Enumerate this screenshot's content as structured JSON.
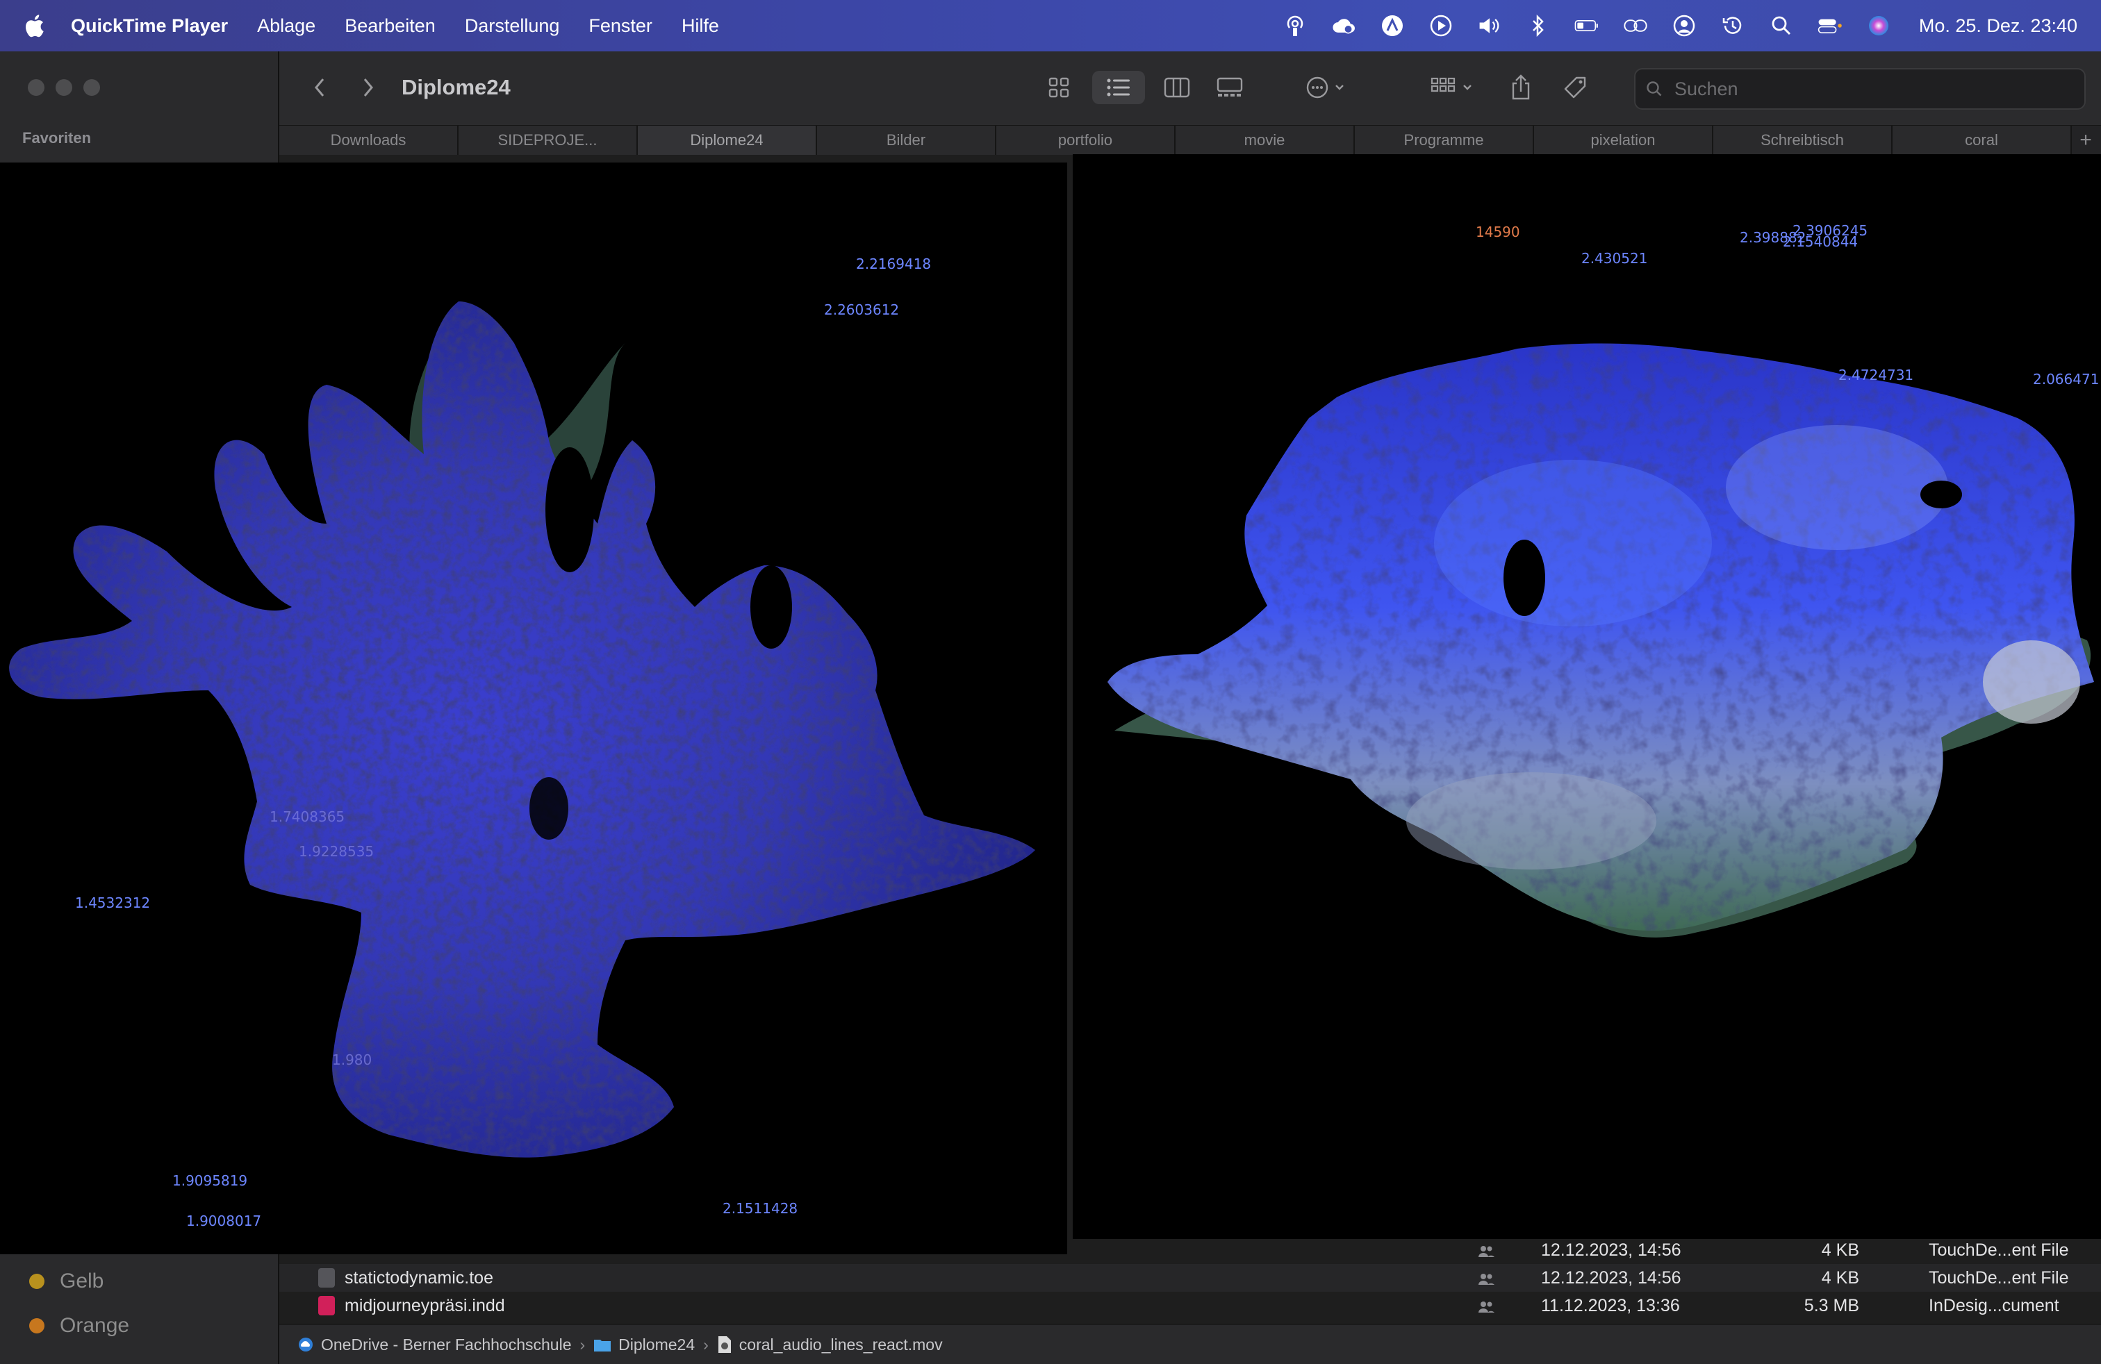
{
  "menubar": {
    "app_name": "QuickTime Player",
    "menus": [
      "Ablage",
      "Bearbeiten",
      "Darstellung",
      "Fenster",
      "Hilfe"
    ],
    "clock": "Mo. 25. Dez. 23:40",
    "status_icons": [
      "airdrop-icon",
      "creative-cloud-icon",
      "app-icon",
      "play-icon",
      "volume-icon",
      "bluetooth-icon",
      "battery-icon",
      "screen-mirroring-icon",
      "user-icon",
      "time-machine-icon",
      "search-icon",
      "control-center-icon",
      "siri-icon"
    ]
  },
  "finder": {
    "folder_title": "Diplome24",
    "search_placeholder": "Suchen",
    "sidebar": {
      "heading": "Favoriten",
      "tags": [
        {
          "label": "Gelb",
          "color": "#b8911e"
        },
        {
          "label": "Orange",
          "color": "#c7771e"
        }
      ]
    },
    "tabs": [
      "Downloads",
      "SIDEPROJE...",
      "Diplome24",
      "Bilder",
      "portfolio",
      "movie",
      "Programme",
      "pixelation",
      "Schreibtisch",
      "coral"
    ],
    "active_tab": "Diplome24",
    "files": [
      {
        "name": "statictodynamic.toe",
        "date": "12.12.2023, 14:56",
        "size": "4 KB",
        "kind": "TouchDe...ent File"
      },
      {
        "name": "midjourneypräsi.indd",
        "date": "11.12.2023, 13:36",
        "size": "5.3 MB",
        "kind": "InDesig...cument"
      }
    ],
    "partial_file": {
      "date": "12.12.2023, 14:56",
      "size": "4 KB",
      "kind": "TouchDe...ent File"
    },
    "path": [
      "OneDrive - Berner Fachhochschule",
      "Diplome24",
      "coral_audio_lines_react.mov"
    ]
  },
  "player_left": {
    "numbers": [
      {
        "text": "2.2169418",
        "cls": ""
      },
      {
        "text": "2.2603612",
        "cls": ""
      },
      {
        "text": "1.7408365",
        "cls": "dim"
      },
      {
        "text": "1.9228535",
        "cls": "dim"
      },
      {
        "text": "1.4532312",
        "cls": ""
      },
      {
        "text": "1.980",
        "cls": "dim"
      },
      {
        "text": "1.9095819",
        "cls": ""
      },
      {
        "text": "1.9008017",
        "cls": ""
      },
      {
        "text": "2.1511428",
        "cls": ""
      }
    ]
  },
  "player_right": {
    "numbers": [
      {
        "text": "14590",
        "cls": "orange"
      },
      {
        "text": "2.430521",
        "cls": ""
      },
      {
        "text": "2.398882",
        "cls": ""
      },
      {
        "text": "2.3906245",
        "cls": ""
      },
      {
        "text": "2.1540844",
        "cls": ""
      },
      {
        "text": "2.4724731",
        "cls": ""
      },
      {
        "text": "2.066471",
        "cls": ""
      }
    ]
  },
  "colors": {
    "accent": "#6d86ff",
    "coral_blue": "#3a42c8",
    "coral_green": "#4f7a6a"
  }
}
